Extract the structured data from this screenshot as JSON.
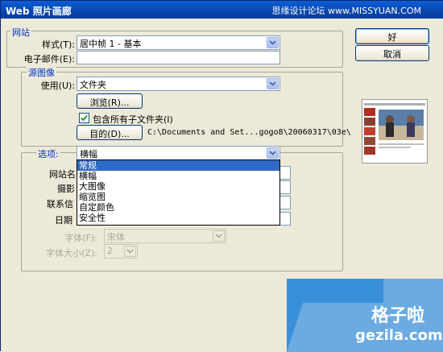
{
  "window": {
    "title": "Web 照片画廊",
    "watermark": "思缘设计论坛 www.MISSYUAN.COM"
  },
  "buttons": {
    "ok": "好",
    "cancel": "取消"
  },
  "site": {
    "legend": "网站",
    "style_label": "样式(T):",
    "style_value": "居中帧 1 - 基本",
    "email_label": "电子邮件(E):",
    "email_value": ""
  },
  "source": {
    "legend": "源图像",
    "use_label": "使用(U):",
    "use_value": "文件夹",
    "browse_button": "浏览(R)...",
    "include_subfolders_label": "包含所有子文件夹(I)",
    "include_subfolders_checked": true,
    "destination_button": "目的(D)...",
    "destination_path": "C:\\Documents and Set...gogo8\\20060317\\03e\\"
  },
  "options": {
    "legend": "选项:",
    "selected": "横幅",
    "dropdown_items": [
      "常规",
      "横幅",
      "大图像",
      "缩览图",
      "自定颜色",
      "安全性"
    ],
    "highlighted_index": 0,
    "site_name_label": "网站名",
    "photographer_label": "摄影",
    "contact_label": "联系信",
    "date_label": "日期",
    "font_label": "字体(F):",
    "font_value": "宋体",
    "font_size_label": "字体大小(Z):",
    "font_size_value": "2"
  },
  "badge": {
    "text": "格子啦",
    "url": "gezila.com"
  },
  "colors": {
    "title_bar": "#0a5fd8",
    "dialog": "#ece9d8",
    "selection": "#316ac5",
    "legend": "#0033cc",
    "badge": "#3a8fd9"
  }
}
